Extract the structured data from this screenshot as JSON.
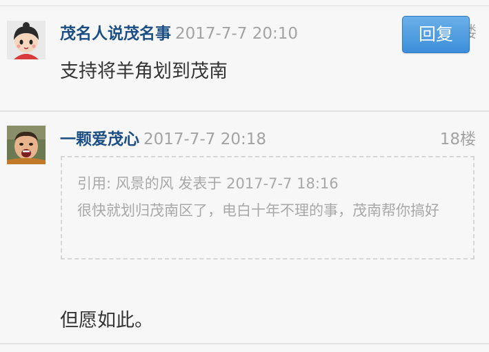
{
  "posts": [
    {
      "author": "茂名人说茂名事",
      "time": "2017-7-7 20:10",
      "content": "支持将羊角划到茂南",
      "reply_label": "回复",
      "floor_partial": "楼",
      "avatar_icon": "cartoon-girl-avatar"
    },
    {
      "author": "一颗爱茂心",
      "time": "2017-7-7 20:18",
      "floor": "18楼",
      "avatar_icon": "child-photo-avatar",
      "quote": {
        "header": "引用: 风景的风 发表于 2017-7-7 18:16",
        "body": "很快就划归茂南区了，电白十年不理的事，茂南帮你搞好"
      },
      "content": "但愿如此。"
    }
  ],
  "colors": {
    "author": "#1a4e84",
    "meta": "#a3a3a3",
    "reply_button": "#4a98dc",
    "background": "#f7f7f7"
  }
}
